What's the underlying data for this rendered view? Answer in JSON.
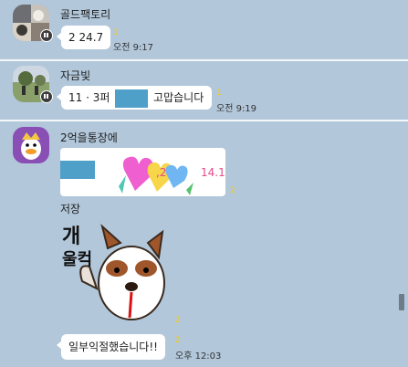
{
  "colors": {
    "background": "#b2c7da",
    "bubble": "#ffffff",
    "unread": "#f5c816",
    "redacted": "#4fa0c8"
  },
  "messages": [
    {
      "sender": "골드팩토리",
      "text": "2 24.7",
      "unread": "1",
      "time": "오전 9:17"
    },
    {
      "sender": "자금빛",
      "text_prefix": "11 · 3퍼",
      "text_suffix": "고맙습니다",
      "unread": "1",
      "time": "오전 9:19"
    },
    {
      "sender": "2억을통장에",
      "image_card_value": "14.1",
      "image_card_partial": ",2",
      "unread": "2",
      "label": "저장",
      "sticker_text": "개울컥",
      "sticker_unread": "2",
      "text": "일부익절했습니다!!",
      "text_unread": "2",
      "time": "오후 12:03"
    }
  ],
  "icons": [
    "profile-photo",
    "profile-photo",
    "duck-avatar-icon",
    "heart-sticker-icon",
    "dog-sticker-icon"
  ]
}
